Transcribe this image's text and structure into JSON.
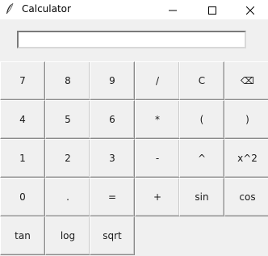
{
  "window": {
    "title": "Calculator",
    "icon": "feather-icon",
    "controls": [
      "minimize-icon",
      "maximize-icon",
      "close-icon"
    ]
  },
  "display": {
    "value": ""
  },
  "keys": [
    [
      "7",
      "8",
      "9",
      "/",
      "C",
      "⌫"
    ],
    [
      "4",
      "5",
      "6",
      "*",
      "(",
      ")"
    ],
    [
      "1",
      "2",
      "3",
      "-",
      "^",
      "x^2"
    ],
    [
      "0",
      ".",
      "=",
      "+",
      "sin",
      "cos"
    ],
    [
      "tan",
      "log",
      "sqrt"
    ]
  ]
}
